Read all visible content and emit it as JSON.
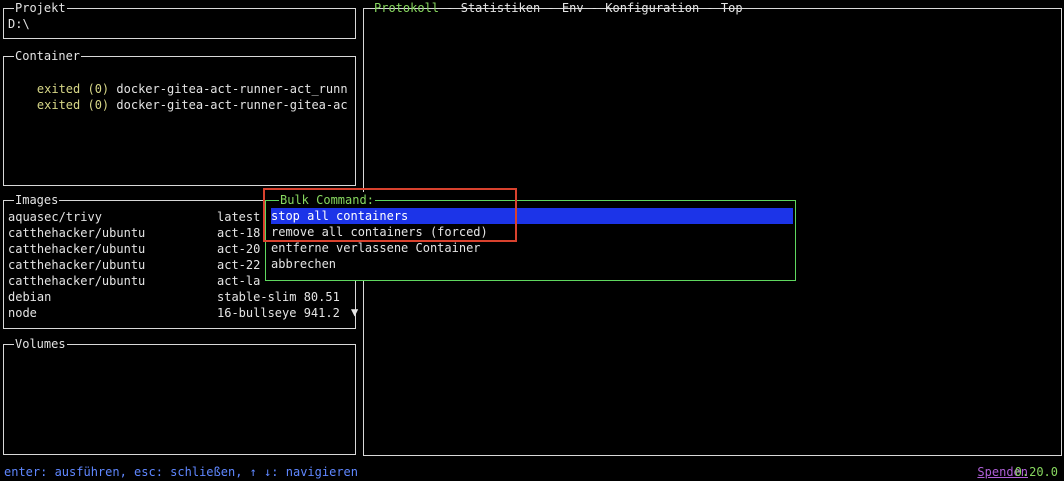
{
  "project": {
    "title": "Projekt",
    "path": "D:\\"
  },
  "containers": {
    "title": "Container",
    "items": [
      {
        "status": "exited (0)",
        "name": "docker-gitea-act-runner-act_runn"
      },
      {
        "status": "exited (0)",
        "name": "docker-gitea-act-runner-gitea-ac"
      }
    ]
  },
  "images": {
    "title": "Images",
    "items": [
      {
        "name": "aquasec/trivy",
        "tag": "latest"
      },
      {
        "name": "catthehacker/ubuntu",
        "tag": "act-18"
      },
      {
        "name": "catthehacker/ubuntu",
        "tag": "act-20"
      },
      {
        "name": "catthehacker/ubuntu",
        "tag": "act-22"
      },
      {
        "name": "catthehacker/ubuntu",
        "tag": "act-la"
      },
      {
        "name": "debian",
        "tag": "stable-slim 80.51"
      },
      {
        "name": "node",
        "tag": "16-bullseye 941.2"
      }
    ],
    "scroll_arrow": "▼"
  },
  "volumes": {
    "title": "Volumes"
  },
  "tabs": [
    {
      "label": "Protokoll",
      "active": true
    },
    {
      "label": "Statistiken",
      "active": false
    },
    {
      "label": "Env",
      "active": false
    },
    {
      "label": "Konfiguration",
      "active": false
    },
    {
      "label": "Top",
      "active": false
    }
  ],
  "tab_separator": " - ",
  "bulk_modal": {
    "title": "Bulk Command:",
    "options": [
      {
        "label": "stop all containers",
        "selected": true
      },
      {
        "label": "remove all containers (forced)",
        "selected": false
      },
      {
        "label": "entferne verlassene Container",
        "selected": false
      },
      {
        "label": "abbrechen",
        "selected": false
      }
    ]
  },
  "footer": {
    "hint": "enter: ausführen, esc: schließen, ↑ ↓: navigieren",
    "donate": "Spenden",
    "version": "0.20.0"
  }
}
